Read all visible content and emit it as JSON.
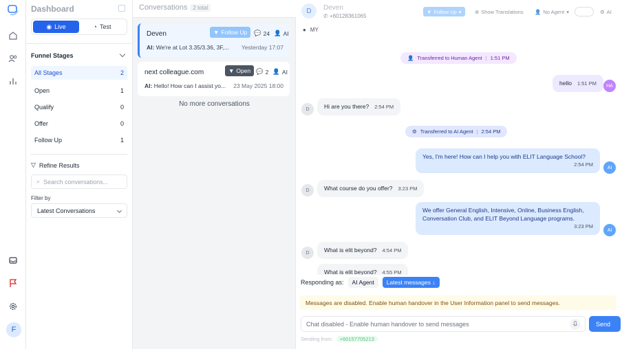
{
  "sidebar": {
    "title": "Dashboard",
    "mode_live": "Live",
    "mode_test": "Test",
    "funnel_title": "Funnel Stages",
    "stages": [
      {
        "label": "All Stages",
        "count": "2"
      },
      {
        "label": "Open",
        "count": "1"
      },
      {
        "label": "Qualify",
        "count": "0"
      },
      {
        "label": "Offer",
        "count": "0"
      },
      {
        "label": "Follow Up",
        "count": "1"
      }
    ],
    "refine_title": "Refine Results",
    "search_placeholder": "Search conversations...",
    "filter_label": "Filter by",
    "filter_value": "Latest Conversations",
    "user_initial": "F"
  },
  "conversations": {
    "title": "Conversations",
    "total": "2 total",
    "items": [
      {
        "name": "Deven",
        "stage": "Follow Up",
        "messages": "24",
        "agent": "AI",
        "sender": "AI:",
        "preview": " We're at Lot 3.35/3.36, 3F,...",
        "time": "Yesterday 17:07"
      },
      {
        "name": "next colleague.com",
        "stage": "Open",
        "messages": "2",
        "agent": "AI",
        "sender": "AI:",
        "preview": " Hello! How can I assist yo...",
        "time": "23 May 2025 18:00"
      }
    ],
    "no_more": "No more conversations"
  },
  "chat": {
    "contact_initial": "D",
    "contact_name": "Deven",
    "contact_phone": "+60128361065",
    "location": "MY",
    "toolbar": {
      "stage": "Follow Up",
      "translations": "Show Translations",
      "agent": "No Agent",
      "ai_label": "AI"
    },
    "events": [
      {
        "text": "Transferred to Human Agent",
        "time": "1:51 PM"
      },
      {
        "text": "Transferred to AI Agent",
        "time": "2:54 PM"
      }
    ],
    "messages": [
      {
        "text": "hello",
        "time": "1:51 PM",
        "avatar": "HA"
      },
      {
        "text": "Hi are you there?",
        "time": "2:54 PM",
        "avatar": "D"
      },
      {
        "text": "Yes, I'm here! How can I help you with ELIT Language School?",
        "time": "2:54 PM",
        "avatar": "AI"
      },
      {
        "text": "What course do you offer?",
        "time": "3:23 PM",
        "avatar": "D"
      },
      {
        "text": "We offer General English, Intensive, Online, Business English, Conversation Club, and ELIT Beyond Language programs.",
        "time": "3:23 PM",
        "avatar": "AI"
      },
      {
        "text": "What is elit beyond?",
        "time": "4:54 PM",
        "avatar": "D"
      },
      {
        "text": "What is elit beyond?",
        "time": "4:55 PM",
        "avatar": "D"
      }
    ],
    "responding_label": "Responding as:",
    "responding_agent": "AI Agent",
    "latest_messages": "Latest messages",
    "warning": "Messages are disabled. Enable human handover in the User Information panel to send messages.",
    "input_placeholder": "Chat disabled - Enable human handover to send messages",
    "send": "Send",
    "sending_from": "Sending from:",
    "sending_number": "+60157705213"
  }
}
